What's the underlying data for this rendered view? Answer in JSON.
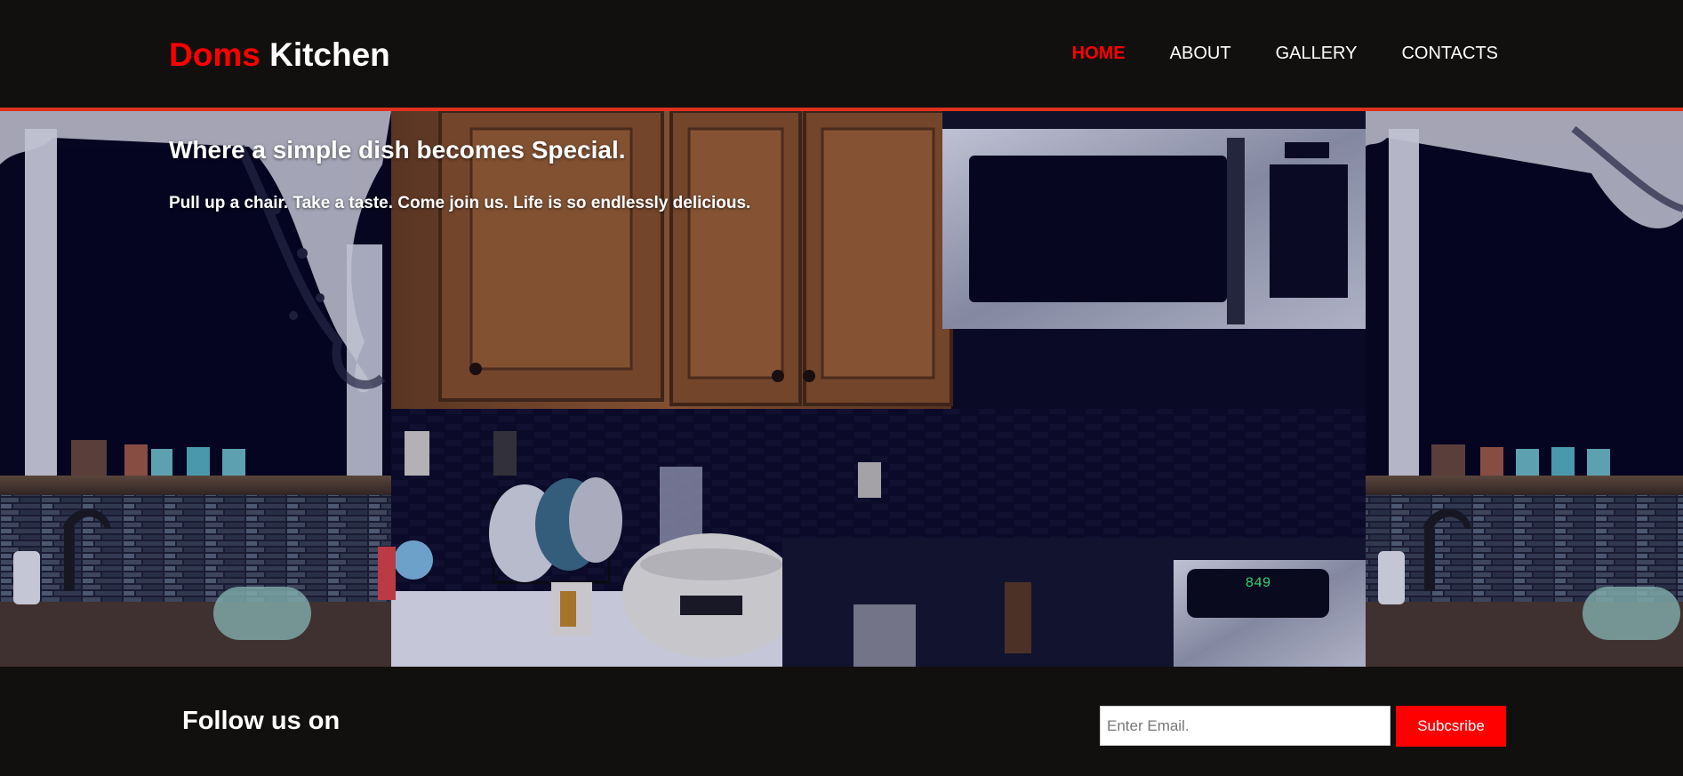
{
  "brand": {
    "accent": "Doms",
    "rest": "Kitchen",
    "accent_color": "#ff0000"
  },
  "nav": {
    "items": [
      {
        "label": "HOME",
        "active": true
      },
      {
        "label": "ABOUT",
        "active": false
      },
      {
        "label": "GALLERY",
        "active": false
      },
      {
        "label": "CONTACTS",
        "active": false
      }
    ]
  },
  "hero": {
    "title": "Where a simple dish becomes Special.",
    "subtitle": "Pull up a chair. Take a taste. Come join us. Life is so endlessly delicious.",
    "image_subject": "kitchen-photo",
    "stove_display": "849"
  },
  "footer": {
    "follow_label": "Follow us on",
    "email_placeholder": "Enter Email.",
    "subscribe_label": "Subcsribe"
  },
  "colors": {
    "background": "#12100e",
    "header_border": "#e0301e",
    "button": "#ff0000"
  }
}
